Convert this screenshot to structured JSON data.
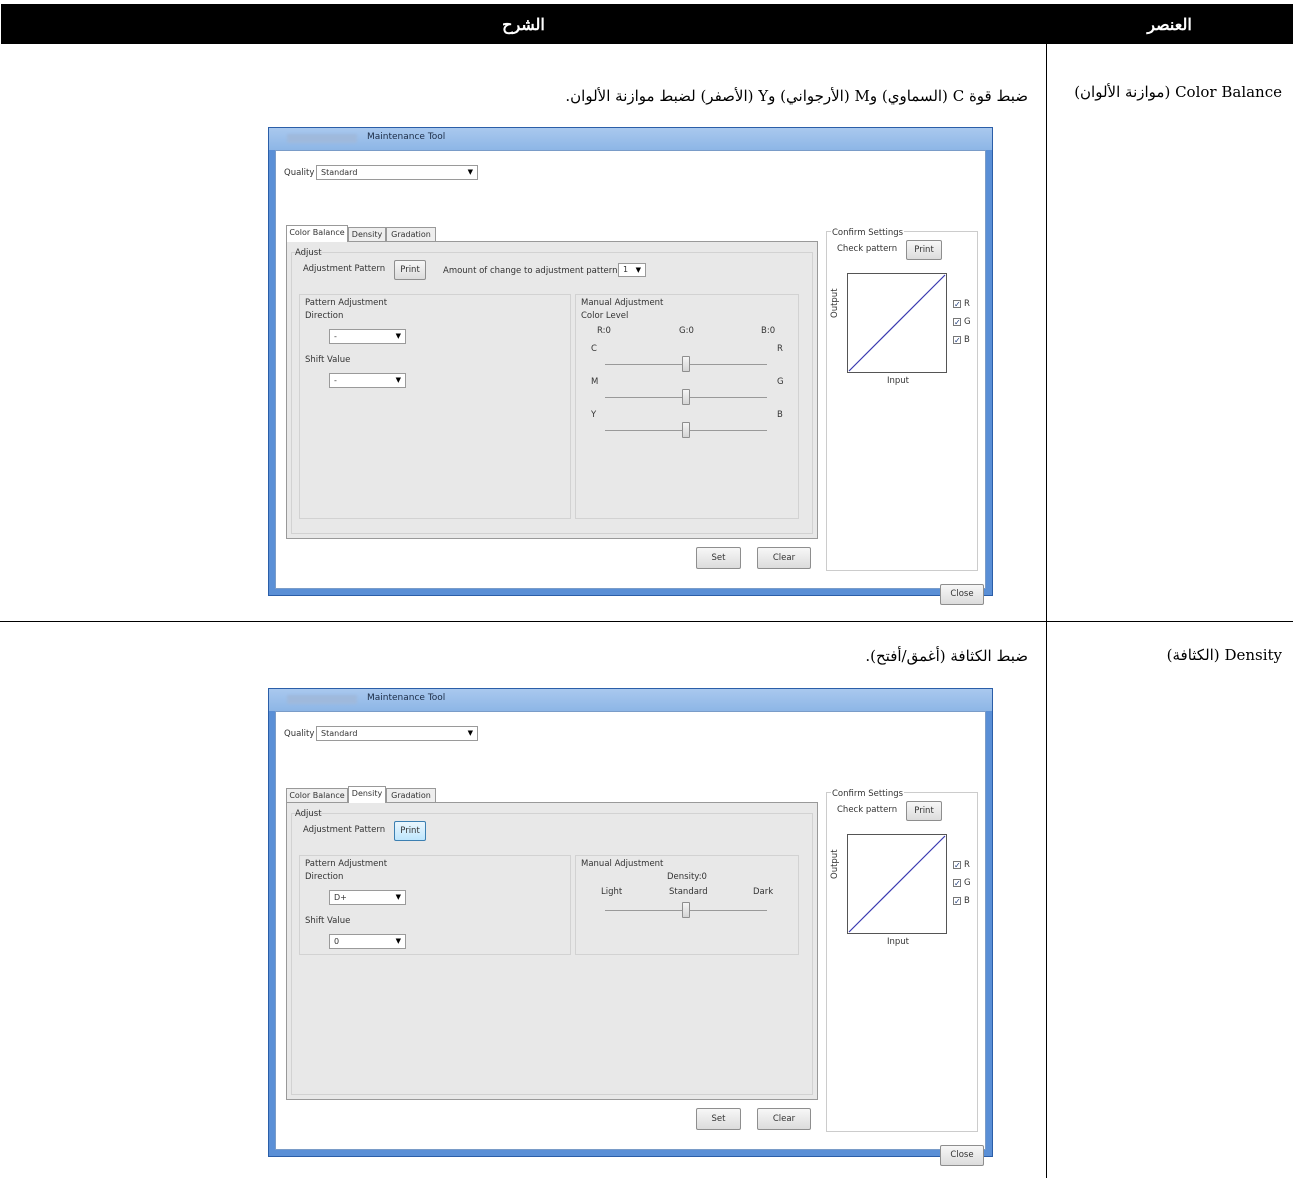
{
  "header": {
    "item": "العنصر",
    "description": "الشرح"
  },
  "rows": [
    {
      "item": "Color Balance (موازنة الألوان)",
      "description": "ضبط قوة C (السماوي) وM (الأرجواني) وY (الأصفر) لضبط موازنة الألوان.",
      "window": {
        "title": "Maintenance Tool",
        "quality_label": "Quality",
        "quality_value": "Standard",
        "tabs": [
          "Color Balance",
          "Density",
          "Gradation"
        ],
        "active_tab": "Color Balance",
        "adjust_label": "Adjust",
        "adjustment_pattern_label": "Adjustment Pattern",
        "print_label": "Print",
        "amount_label": "Amount of change to adjustment pattern",
        "amount_value": "1",
        "pattern_adjustment_label": "Pattern Adjustment",
        "direction_label": "Direction",
        "direction_value": "-",
        "shift_label": "Shift Value",
        "shift_value": "-",
        "manual_label": "Manual Adjustment",
        "color_level_label": "Color Level",
        "levels": {
          "r": "R:0",
          "g": "G:0",
          "b": "B:0"
        },
        "slider_rows": [
          {
            "left": "C",
            "right": "R"
          },
          {
            "left": "M",
            "right": "G"
          },
          {
            "left": "Y",
            "right": "B"
          }
        ],
        "confirm_label": "Confirm Settings",
        "check_pattern_label": "Check pattern",
        "output_label": "Output",
        "input_label": "Input",
        "checkboxes": [
          "R",
          "G",
          "B"
        ],
        "set_label": "Set",
        "clear_label": "Clear",
        "close_label": "Close"
      }
    },
    {
      "item": "Density (الكثافة)",
      "description": "ضبط الكثافة (أغمق/أفتح).",
      "window": {
        "title": "Maintenance Tool",
        "quality_label": "Quality",
        "quality_value": "Standard",
        "tabs": [
          "Color Balance",
          "Density",
          "Gradation"
        ],
        "active_tab": "Density",
        "adjust_label": "Adjust",
        "adjustment_pattern_label": "Adjustment Pattern",
        "print_label": "Print",
        "pattern_adjustment_label": "Pattern Adjustment",
        "direction_label": "Direction",
        "direction_value": "D+",
        "shift_label": "Shift Value",
        "shift_value": "0",
        "manual_label": "Manual Adjustment",
        "density_value": "Density:0",
        "density_scale": {
          "light": "Light",
          "standard": "Standard",
          "dark": "Dark"
        },
        "confirm_label": "Confirm Settings",
        "check_pattern_label": "Check pattern",
        "output_label": "Output",
        "input_label": "Input",
        "checkboxes": [
          "R",
          "G",
          "B"
        ],
        "set_label": "Set",
        "clear_label": "Clear",
        "close_label": "Close"
      }
    }
  ]
}
